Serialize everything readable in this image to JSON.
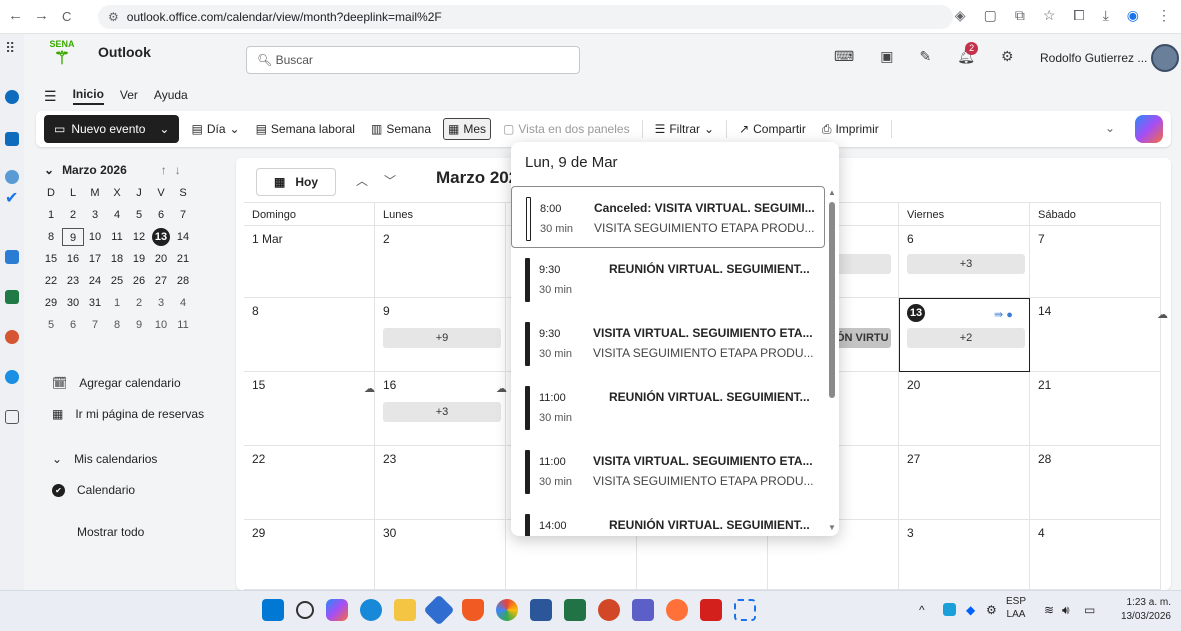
{
  "browser": {
    "url": "outlook.office.com/calendar/view/month?deeplink=mail%2F",
    "back_icon": "←",
    "forward_icon": "→",
    "reload_icon": "C"
  },
  "app": {
    "name": "Outlook",
    "brand_text": "SENA",
    "brand_color": "#39a900"
  },
  "search": {
    "placeholder": "Buscar"
  },
  "user": {
    "name": "Rodolfo Gutierrez ...",
    "notification_count": "2"
  },
  "menu_tabs": [
    "Inicio",
    "Ver",
    "Ayuda"
  ],
  "ribbon": {
    "new_event": "Nuevo evento",
    "day": "Día",
    "work_week": "Semana laboral",
    "week": "Semana",
    "month": "Mes",
    "split_view": "Vista en dos paneles",
    "filter": "Filtrar",
    "share": "Compartir",
    "print": "Imprimir"
  },
  "mini_calendar": {
    "title": "Marzo 2026",
    "weekday_initials": [
      "D",
      "L",
      "M",
      "X",
      "J",
      "V",
      "S"
    ],
    "days": [
      "1",
      "2",
      "3",
      "4",
      "5",
      "6",
      "7",
      "8",
      "9",
      "10",
      "11",
      "12",
      "13",
      "14",
      "15",
      "16",
      "17",
      "18",
      "19",
      "20",
      "21",
      "22",
      "23",
      "24",
      "25",
      "26",
      "27",
      "28",
      "29",
      "30",
      "31",
      "1",
      "2",
      "3",
      "4",
      "5",
      "6",
      "7",
      "8",
      "9",
      "10",
      "11"
    ],
    "selected_day": "9",
    "today": "13"
  },
  "sidebar_links": {
    "add_calendar": "Agregar calendario",
    "booking_page": "Ir mi página de reservas",
    "my_calendars": "Mis calendarios",
    "calendar": "Calendario",
    "show_all": "Mostrar todo"
  },
  "calendar": {
    "today_button": "Hoy",
    "month_title": "Marzo 202",
    "column_headers": [
      "Domingo",
      "Lunes",
      "",
      "",
      "",
      "Viernes",
      "Sábado"
    ],
    "weeks": [
      [
        "1 Mar",
        "2",
        "",
        "",
        "",
        "6",
        "7"
      ],
      [
        "8",
        "9",
        "",
        "",
        "",
        "13",
        "14"
      ],
      [
        "15",
        "16",
        "",
        "",
        "",
        "20",
        "21"
      ],
      [
        "22",
        "23",
        "",
        "",
        "",
        "27",
        "28"
      ],
      [
        "29",
        "30",
        "",
        "",
        "",
        "3",
        "4"
      ]
    ],
    "more_labels": {
      "mon9": "+9",
      "fri6": "+3",
      "fri13": "+2",
      "mon16": "+3"
    },
    "partial_event": "NIÓN VIRTU"
  },
  "popup": {
    "title": "Lun, 9 de Mar",
    "events": [
      {
        "time": "8:00",
        "duration": "30 min",
        "title": "Canceled: VISITA VIRTUAL. SEGUIMI...",
        "subtitle": "VISITA SEGUIMIENTO ETAPA PRODU..."
      },
      {
        "time": "9:30",
        "duration": "30 min",
        "title": "REUNIÓN VIRTUAL. SEGUIMIENT...",
        "subtitle": ""
      },
      {
        "time": "9:30",
        "duration": "30 min",
        "title": "VISITA VIRTUAL. SEGUIMIENTO ETA...",
        "subtitle": "VISITA SEGUIMIENTO ETAPA PRODU..."
      },
      {
        "time": "11:00",
        "duration": "30 min",
        "title": "REUNIÓN VIRTUAL. SEGUIMIENT...",
        "subtitle": ""
      },
      {
        "time": "11:00",
        "duration": "30 min",
        "title": "VISITA VIRTUAL. SEGUIMIENTO ETA...",
        "subtitle": "VISITA SEGUIMIENTO ETAPA PRODU..."
      },
      {
        "time": "14:00",
        "duration": "",
        "title": "REUNIÓN VIRTUAL. SEGUIMIENT...",
        "subtitle": ""
      }
    ]
  },
  "taskbar": {
    "language": "ESP",
    "layout": "LAA",
    "time": "1:23 a. m.",
    "date": "13/03/2026"
  }
}
